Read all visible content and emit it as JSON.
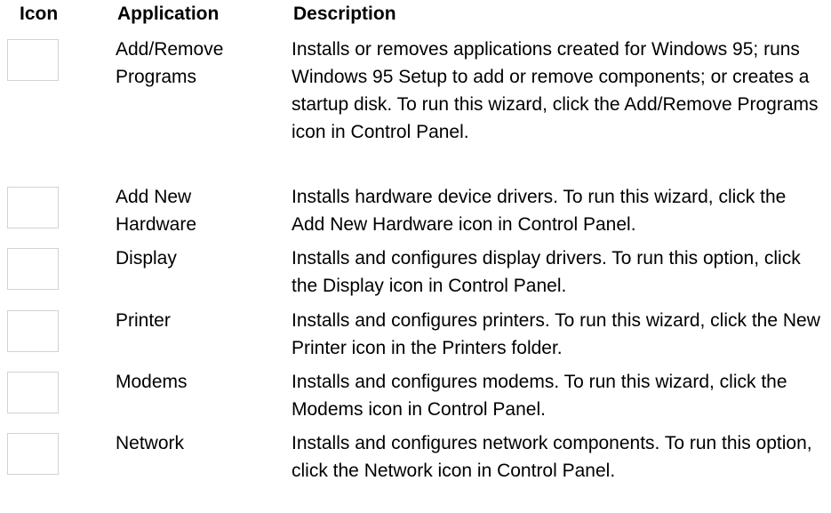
{
  "headers": {
    "icon": "Icon",
    "application": "Application",
    "description": "Description"
  },
  "rows": [
    {
      "icon": "add-remove-programs-icon",
      "application": "Add/Remove Programs",
      "description": "Installs or removes applications created for Windows 95; runs Windows 95 Setup to add or remove components; or creates a startup disk. To run this wizard, click the Add/Remove Programs icon in Control Panel."
    },
    {
      "icon": "add-new-hardware-icon",
      "application": "Add New Hardware",
      "description": "Installs hardware device drivers. To run this wizard, click the Add New Hardware icon in Control Panel."
    },
    {
      "icon": "display-icon",
      "application": "Display",
      "description": "Installs and configures display drivers. To run this option, click the Display icon in Control Panel."
    },
    {
      "icon": "printer-icon",
      "application": "Printer",
      "description": "Installs and configures printers. To run this wizard, click the New Printer icon in the Printers folder."
    },
    {
      "icon": "modems-icon",
      "application": "Modems",
      "description": "Installs and configures modems. To run this wizard, click the Modems icon in Control Panel."
    },
    {
      "icon": "network-icon",
      "application": "Network",
      "description": "Installs and configures network components. To run this option, click the Network icon in Control Panel."
    }
  ]
}
